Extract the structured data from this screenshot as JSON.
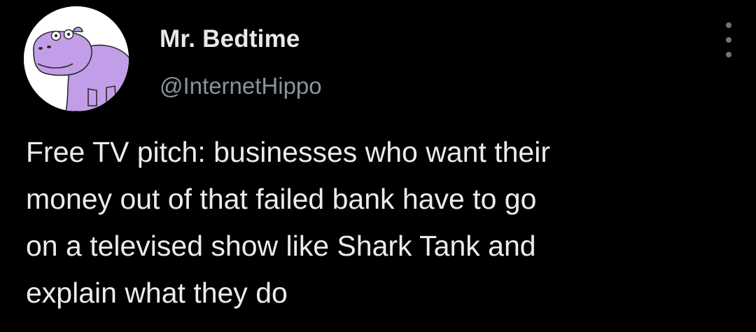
{
  "author": {
    "display_name": "Mr. Bedtime",
    "handle": "@InternetHippo",
    "avatar_icon": "purple-hippo-avatar"
  },
  "tweet": {
    "text_lines": [
      "Free TV pitch: businesses who want their",
      "money out of that failed bank have to go",
      "on a televised show like Shark Tank and",
      "explain what they do"
    ]
  },
  "colors": {
    "background": "#000000",
    "text_primary": "#e7e9ea",
    "text_secondary": "#8b9299",
    "avatar_hippo": "#c39ee8"
  },
  "icons": {
    "more": "more-options-icon"
  }
}
